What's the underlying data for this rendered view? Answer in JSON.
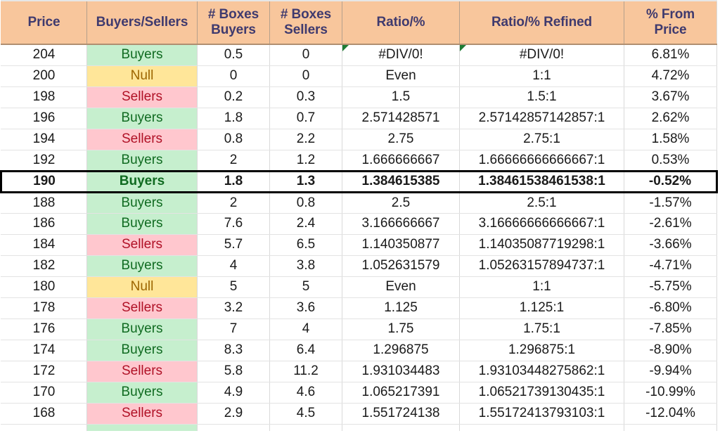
{
  "table": {
    "columns": [
      {
        "key": "price",
        "label_lines": [
          "Price"
        ]
      },
      {
        "key": "bs",
        "label_lines": [
          "Buyers/Sellers"
        ]
      },
      {
        "key": "boxes_b",
        "label_lines": [
          "# Boxes",
          "Buyers"
        ]
      },
      {
        "key": "boxes_s",
        "label_lines": [
          "# Boxes",
          "Sellers"
        ]
      },
      {
        "key": "ratio",
        "label_lines": [
          "Ratio/%"
        ]
      },
      {
        "key": "refined",
        "label_lines": [
          "Ratio/% Refined"
        ]
      },
      {
        "key": "pct",
        "label_lines": [
          "% From",
          "Price"
        ]
      }
    ],
    "header_bg": "#F8C69C",
    "header_text_color": "#3F3A6E",
    "fill_colors": {
      "buyers": "#C6EFCE",
      "sellers": "#FFC7CE",
      "null": "#FFE699"
    },
    "text_colors": {
      "buyers": "#106B21",
      "sellers": "#B01126",
      "null": "#9C6500"
    },
    "highlight_border_color": "#000000",
    "error_marker_color": "#1E7B34",
    "rows": [
      {
        "price": "204",
        "bs": "Buyers",
        "bs_state": "buyers",
        "boxes_b": "0.5",
        "boxes_s": "0",
        "ratio": "#DIV/0!",
        "refined": "#DIV/0!",
        "pct": "6.81%",
        "ratio_error": true,
        "refined_error": true,
        "highlight": false
      },
      {
        "price": "200",
        "bs": "Null",
        "bs_state": "null",
        "boxes_b": "0",
        "boxes_s": "0",
        "ratio": "Even",
        "refined": "1:1",
        "pct": "4.72%",
        "ratio_error": false,
        "refined_error": false,
        "highlight": false
      },
      {
        "price": "198",
        "bs": "Sellers",
        "bs_state": "sellers",
        "boxes_b": "0.2",
        "boxes_s": "0.3",
        "ratio": "1.5",
        "refined": "1.5:1",
        "pct": "3.67%",
        "ratio_error": false,
        "refined_error": false,
        "highlight": false
      },
      {
        "price": "196",
        "bs": "Buyers",
        "bs_state": "buyers",
        "boxes_b": "1.8",
        "boxes_s": "0.7",
        "ratio": "2.571428571",
        "refined": "2.57142857142857:1",
        "pct": "2.62%",
        "ratio_error": false,
        "refined_error": false,
        "highlight": false
      },
      {
        "price": "194",
        "bs": "Sellers",
        "bs_state": "sellers",
        "boxes_b": "0.8",
        "boxes_s": "2.2",
        "ratio": "2.75",
        "refined": "2.75:1",
        "pct": "1.58%",
        "ratio_error": false,
        "refined_error": false,
        "highlight": false
      },
      {
        "price": "192",
        "bs": "Buyers",
        "bs_state": "buyers",
        "boxes_b": "2",
        "boxes_s": "1.2",
        "ratio": "1.666666667",
        "refined": "1.66666666666667:1",
        "pct": "0.53%",
        "ratio_error": false,
        "refined_error": false,
        "highlight": false
      },
      {
        "price": "190",
        "bs": "Buyers",
        "bs_state": "buyers",
        "boxes_b": "1.8",
        "boxes_s": "1.3",
        "ratio": "1.384615385",
        "refined": "1.38461538461538:1",
        "pct": "-0.52%",
        "ratio_error": false,
        "refined_error": false,
        "highlight": true
      },
      {
        "price": "188",
        "bs": "Buyers",
        "bs_state": "buyers",
        "boxes_b": "2",
        "boxes_s": "0.8",
        "ratio": "2.5",
        "refined": "2.5:1",
        "pct": "-1.57%",
        "ratio_error": false,
        "refined_error": false,
        "highlight": false
      },
      {
        "price": "186",
        "bs": "Buyers",
        "bs_state": "buyers",
        "boxes_b": "7.6",
        "boxes_s": "2.4",
        "ratio": "3.166666667",
        "refined": "3.16666666666667:1",
        "pct": "-2.61%",
        "ratio_error": false,
        "refined_error": false,
        "highlight": false
      },
      {
        "price": "184",
        "bs": "Sellers",
        "bs_state": "sellers",
        "boxes_b": "5.7",
        "boxes_s": "6.5",
        "ratio": "1.140350877",
        "refined": "1.14035087719298:1",
        "pct": "-3.66%",
        "ratio_error": false,
        "refined_error": false,
        "highlight": false
      },
      {
        "price": "182",
        "bs": "Buyers",
        "bs_state": "buyers",
        "boxes_b": "4",
        "boxes_s": "3.8",
        "ratio": "1.052631579",
        "refined": "1.05263157894737:1",
        "pct": "-4.71%",
        "ratio_error": false,
        "refined_error": false,
        "highlight": false
      },
      {
        "price": "180",
        "bs": "Null",
        "bs_state": "null",
        "boxes_b": "5",
        "boxes_s": "5",
        "ratio": "Even",
        "refined": "1:1",
        "pct": "-5.75%",
        "ratio_error": false,
        "refined_error": false,
        "highlight": false
      },
      {
        "price": "178",
        "bs": "Sellers",
        "bs_state": "sellers",
        "boxes_b": "3.2",
        "boxes_s": "3.6",
        "ratio": "1.125",
        "refined": "1.125:1",
        "pct": "-6.80%",
        "ratio_error": false,
        "refined_error": false,
        "highlight": false
      },
      {
        "price": "176",
        "bs": "Buyers",
        "bs_state": "buyers",
        "boxes_b": "7",
        "boxes_s": "4",
        "ratio": "1.75",
        "refined": "1.75:1",
        "pct": "-7.85%",
        "ratio_error": false,
        "refined_error": false,
        "highlight": false
      },
      {
        "price": "174",
        "bs": "Buyers",
        "bs_state": "buyers",
        "boxes_b": "8.3",
        "boxes_s": "6.4",
        "ratio": "1.296875",
        "refined": "1.296875:1",
        "pct": "-8.90%",
        "ratio_error": false,
        "refined_error": false,
        "highlight": false
      },
      {
        "price": "172",
        "bs": "Sellers",
        "bs_state": "sellers",
        "boxes_b": "5.8",
        "boxes_s": "11.2",
        "ratio": "1.931034483",
        "refined": "1.93103448275862:1",
        "pct": "-9.94%",
        "ratio_error": false,
        "refined_error": false,
        "highlight": false
      },
      {
        "price": "170",
        "bs": "Buyers",
        "bs_state": "buyers",
        "boxes_b": "4.9",
        "boxes_s": "4.6",
        "ratio": "1.065217391",
        "refined": "1.06521739130435:1",
        "pct": "-10.99%",
        "ratio_error": false,
        "refined_error": false,
        "highlight": false
      },
      {
        "price": "168",
        "bs": "Sellers",
        "bs_state": "sellers",
        "boxes_b": "2.9",
        "boxes_s": "4.5",
        "ratio": "1.551724138",
        "refined": "1.55172413793103:1",
        "pct": "-12.04%",
        "ratio_error": false,
        "refined_error": false,
        "highlight": false
      },
      {
        "price": "",
        "bs": "",
        "bs_state": "buyers",
        "boxes_b": "",
        "boxes_s": "",
        "ratio": "",
        "refined": "",
        "pct": "",
        "ratio_error": false,
        "refined_error": false,
        "highlight": false,
        "clipped": true
      }
    ]
  }
}
